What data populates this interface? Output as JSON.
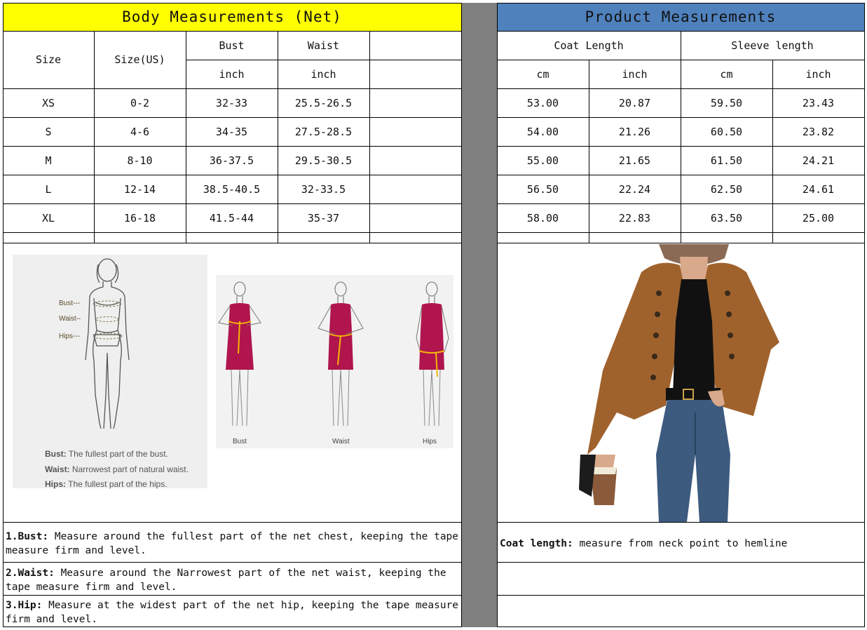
{
  "body": {
    "title": "Body Measurements (Net)",
    "size_label": "Size",
    "size_us_label": "Size(US)",
    "bust_label": "Bust",
    "waist_label": "Waist",
    "unit_inch_1": "inch",
    "unit_inch_2": "inch",
    "rows": [
      {
        "size": "XS",
        "us": "0-2",
        "bust": "32-33",
        "waist": "25.5-26.5"
      },
      {
        "size": "S",
        "us": "4-6",
        "bust": "34-35",
        "waist": "27.5-28.5"
      },
      {
        "size": "M",
        "us": "8-10",
        "bust": "36-37.5",
        "waist": "29.5-30.5"
      },
      {
        "size": "L",
        "us": "12-14",
        "bust": "38.5-40.5",
        "waist": "32-33.5"
      },
      {
        "size": "XL",
        "us": "16-18",
        "bust": "41.5-44",
        "waist": "35-37"
      }
    ]
  },
  "product": {
    "title": "Product Measurements",
    "coat_label": "Coat Length",
    "sleeve_label": "Sleeve length",
    "u_cm_1": "cm",
    "u_inch_1": "inch",
    "u_cm_2": "cm",
    "u_inch_2": "inch",
    "rows": [
      {
        "coat_cm": "53.00",
        "coat_in": "20.87",
        "sleeve_cm": "59.50",
        "sleeve_in": "23.43"
      },
      {
        "coat_cm": "54.00",
        "coat_in": "21.26",
        "sleeve_cm": "60.50",
        "sleeve_in": "23.82"
      },
      {
        "coat_cm": "55.00",
        "coat_in": "21.65",
        "sleeve_cm": "61.50",
        "sleeve_in": "24.21"
      },
      {
        "coat_cm": "56.50",
        "coat_in": "22.24",
        "sleeve_cm": "62.50",
        "sleeve_in": "24.61"
      },
      {
        "coat_cm": "58.00",
        "coat_in": "22.83",
        "sleeve_cm": "63.50",
        "sleeve_in": "25.00"
      }
    ]
  },
  "diagram1": {
    "bust": "Bust---",
    "waist": "Waist--",
    "hips": "Hips---",
    "legend_bust_k": "Bust:",
    "legend_bust_v": "The fullest part of the bust.",
    "legend_waist_k": "Waist:",
    "legend_waist_v": "Narrowest part of natural waist.",
    "legend_hips_k": "Hips:",
    "legend_hips_v": "The fullest part of the hips."
  },
  "diagram2": {
    "bust": "Bust",
    "waist": "Waist",
    "hips": "Hips"
  },
  "notes": {
    "bust_k": "1.Bust:",
    "bust_v": " Measure around the fullest part of the net chest, keeping the tape  measure firm and level.",
    "waist_k": "2.Waist:",
    "waist_v": " Measure around the Narrowest part of the net waist, keeping the tape  measure firm and level.",
    "hip_k": "3.Hip:",
    "hip_v": " Measure at the widest part of the net hip, keeping the tape measure firm and level.",
    "coat_k": "Coat length:",
    "coat_v": " measure from neck point to hemline"
  },
  "colors": {
    "body_header": "#FFFF00",
    "product_header": "#4F81BD",
    "divider": "#808080",
    "dress": "#B0154D",
    "tape": "#F2B705",
    "jacket": "#A0622D"
  }
}
